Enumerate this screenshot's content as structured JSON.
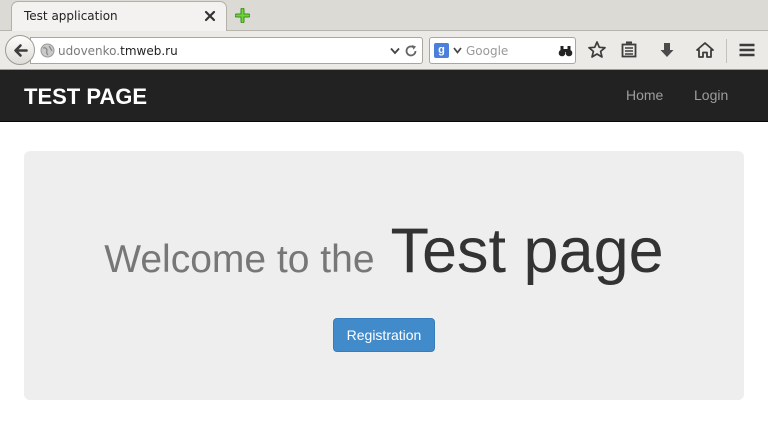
{
  "browser": {
    "tab_title": "Test application",
    "url_prefix": "udovenko.",
    "url_domain": "tmweb.ru",
    "search_placeholder": "Google"
  },
  "navbar": {
    "brand": "TEST PAGE",
    "links": [
      "Home",
      "Login"
    ]
  },
  "jumbotron": {
    "welcome": "Welcome to the",
    "title": "Test page",
    "button": "Registration"
  },
  "colors": {
    "navbar_bg": "#222222",
    "jumbotron_bg": "#eeeeee",
    "primary": "#428bca"
  }
}
